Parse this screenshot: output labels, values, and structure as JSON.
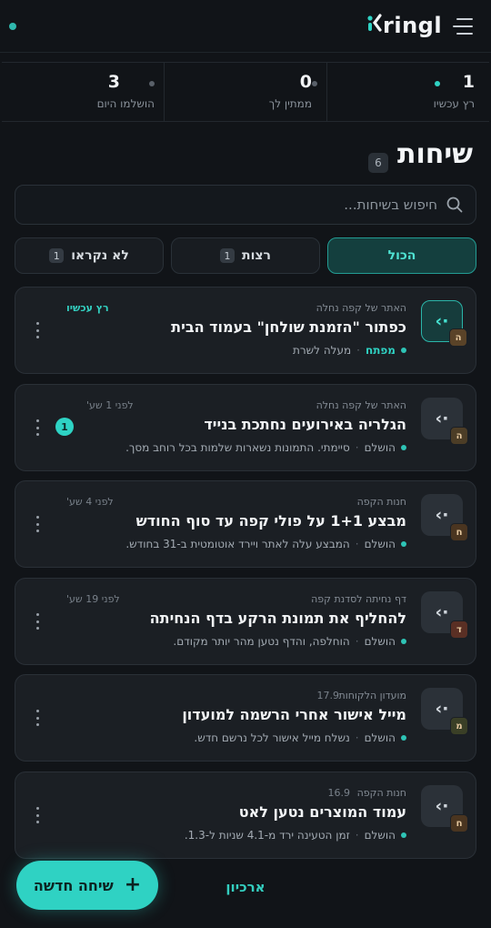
{
  "header": {
    "logo_mark": "✓",
    "logo_text": "ringl",
    "menu_icon": "hamburger-icon",
    "status_color": "#2fb8ad"
  },
  "stats": [
    {
      "value": "1",
      "label": "רץ עכשיו",
      "dot_color": "#2fd2c3"
    },
    {
      "value": "0",
      "label": "ממתין לך",
      "dot_color": "#596069"
    },
    {
      "value": "3",
      "label": "הושלמו היום",
      "dot_color": "#596069"
    }
  ],
  "page": {
    "title": "שיחות",
    "count": "6"
  },
  "search": {
    "placeholder": "חיפוש בשיחות..."
  },
  "tabs": [
    {
      "label": "הכול",
      "badge": "",
      "active": true
    },
    {
      "label": "רצות",
      "badge": "1",
      "active": false
    },
    {
      "label": "לא נקראו",
      "badge": "1",
      "active": false
    }
  ],
  "conversations": [
    {
      "project": "האתר של קפה נחלה",
      "title": "כפתור \"הזמנת שולחן\" בעמוד הבית",
      "status": "מפתח",
      "summary": "מעלה לשרת",
      "time": "רץ עכשיו",
      "avatar_letter": "ה",
      "running": true,
      "unread": ""
    },
    {
      "project": "האתר של קפה נחלה",
      "title": "הגלריה באירועים נחתכת בנייד",
      "status": "הושלם",
      "summary": "סיימתי. התמונות נשארות שלמות בכל רוחב מסך.",
      "time": "לפני 1 שע'",
      "avatar_letter": "ה",
      "running": false,
      "unread": "1"
    },
    {
      "project": "חנות הקפה",
      "title": "מבצע 1+1 על פולי קפה עד סוף החודש",
      "status": "הושלם",
      "summary": "המבצע עלה לאתר ויירד אוטומטית ב-31 בחודש.",
      "time": "לפני 4 שע'",
      "avatar_letter": "ח",
      "running": false,
      "unread": ""
    },
    {
      "project": "דף נחיתה לסדנת קפה",
      "title": "להחליף את תמונת הרקע בדף הנחיתה",
      "status": "הושלם",
      "summary": "הוחלפה, והדף נטען מהר יותר מקודם.",
      "time": "לפני 19 שע'",
      "avatar_letter": "ד",
      "running": false,
      "unread": ""
    },
    {
      "project": "מועדון הלקוחות",
      "title": "מייל אישור אחרי הרשמה למועדון",
      "status": "הושלם",
      "summary": "נשלח מייל אישור לכל נרשם חדש.",
      "time": "17.9",
      "avatar_letter": "מ",
      "running": false,
      "unread": ""
    },
    {
      "project": "חנות הקפה",
      "title": "עמוד המוצרים נטען לאט",
      "status": "הושלם",
      "summary": "זמן הטעינה ירד מ-4.1 שניות ל-1.3.",
      "time": "16.9",
      "avatar_letter": "ח",
      "running": false,
      "unread": ""
    }
  ],
  "footer": {
    "new_chat": "שיחה חדשה",
    "archive": "ארכיון"
  },
  "colors": {
    "accent": "#2fd2c3",
    "background": "#111418",
    "card": "#1b1f24"
  }
}
